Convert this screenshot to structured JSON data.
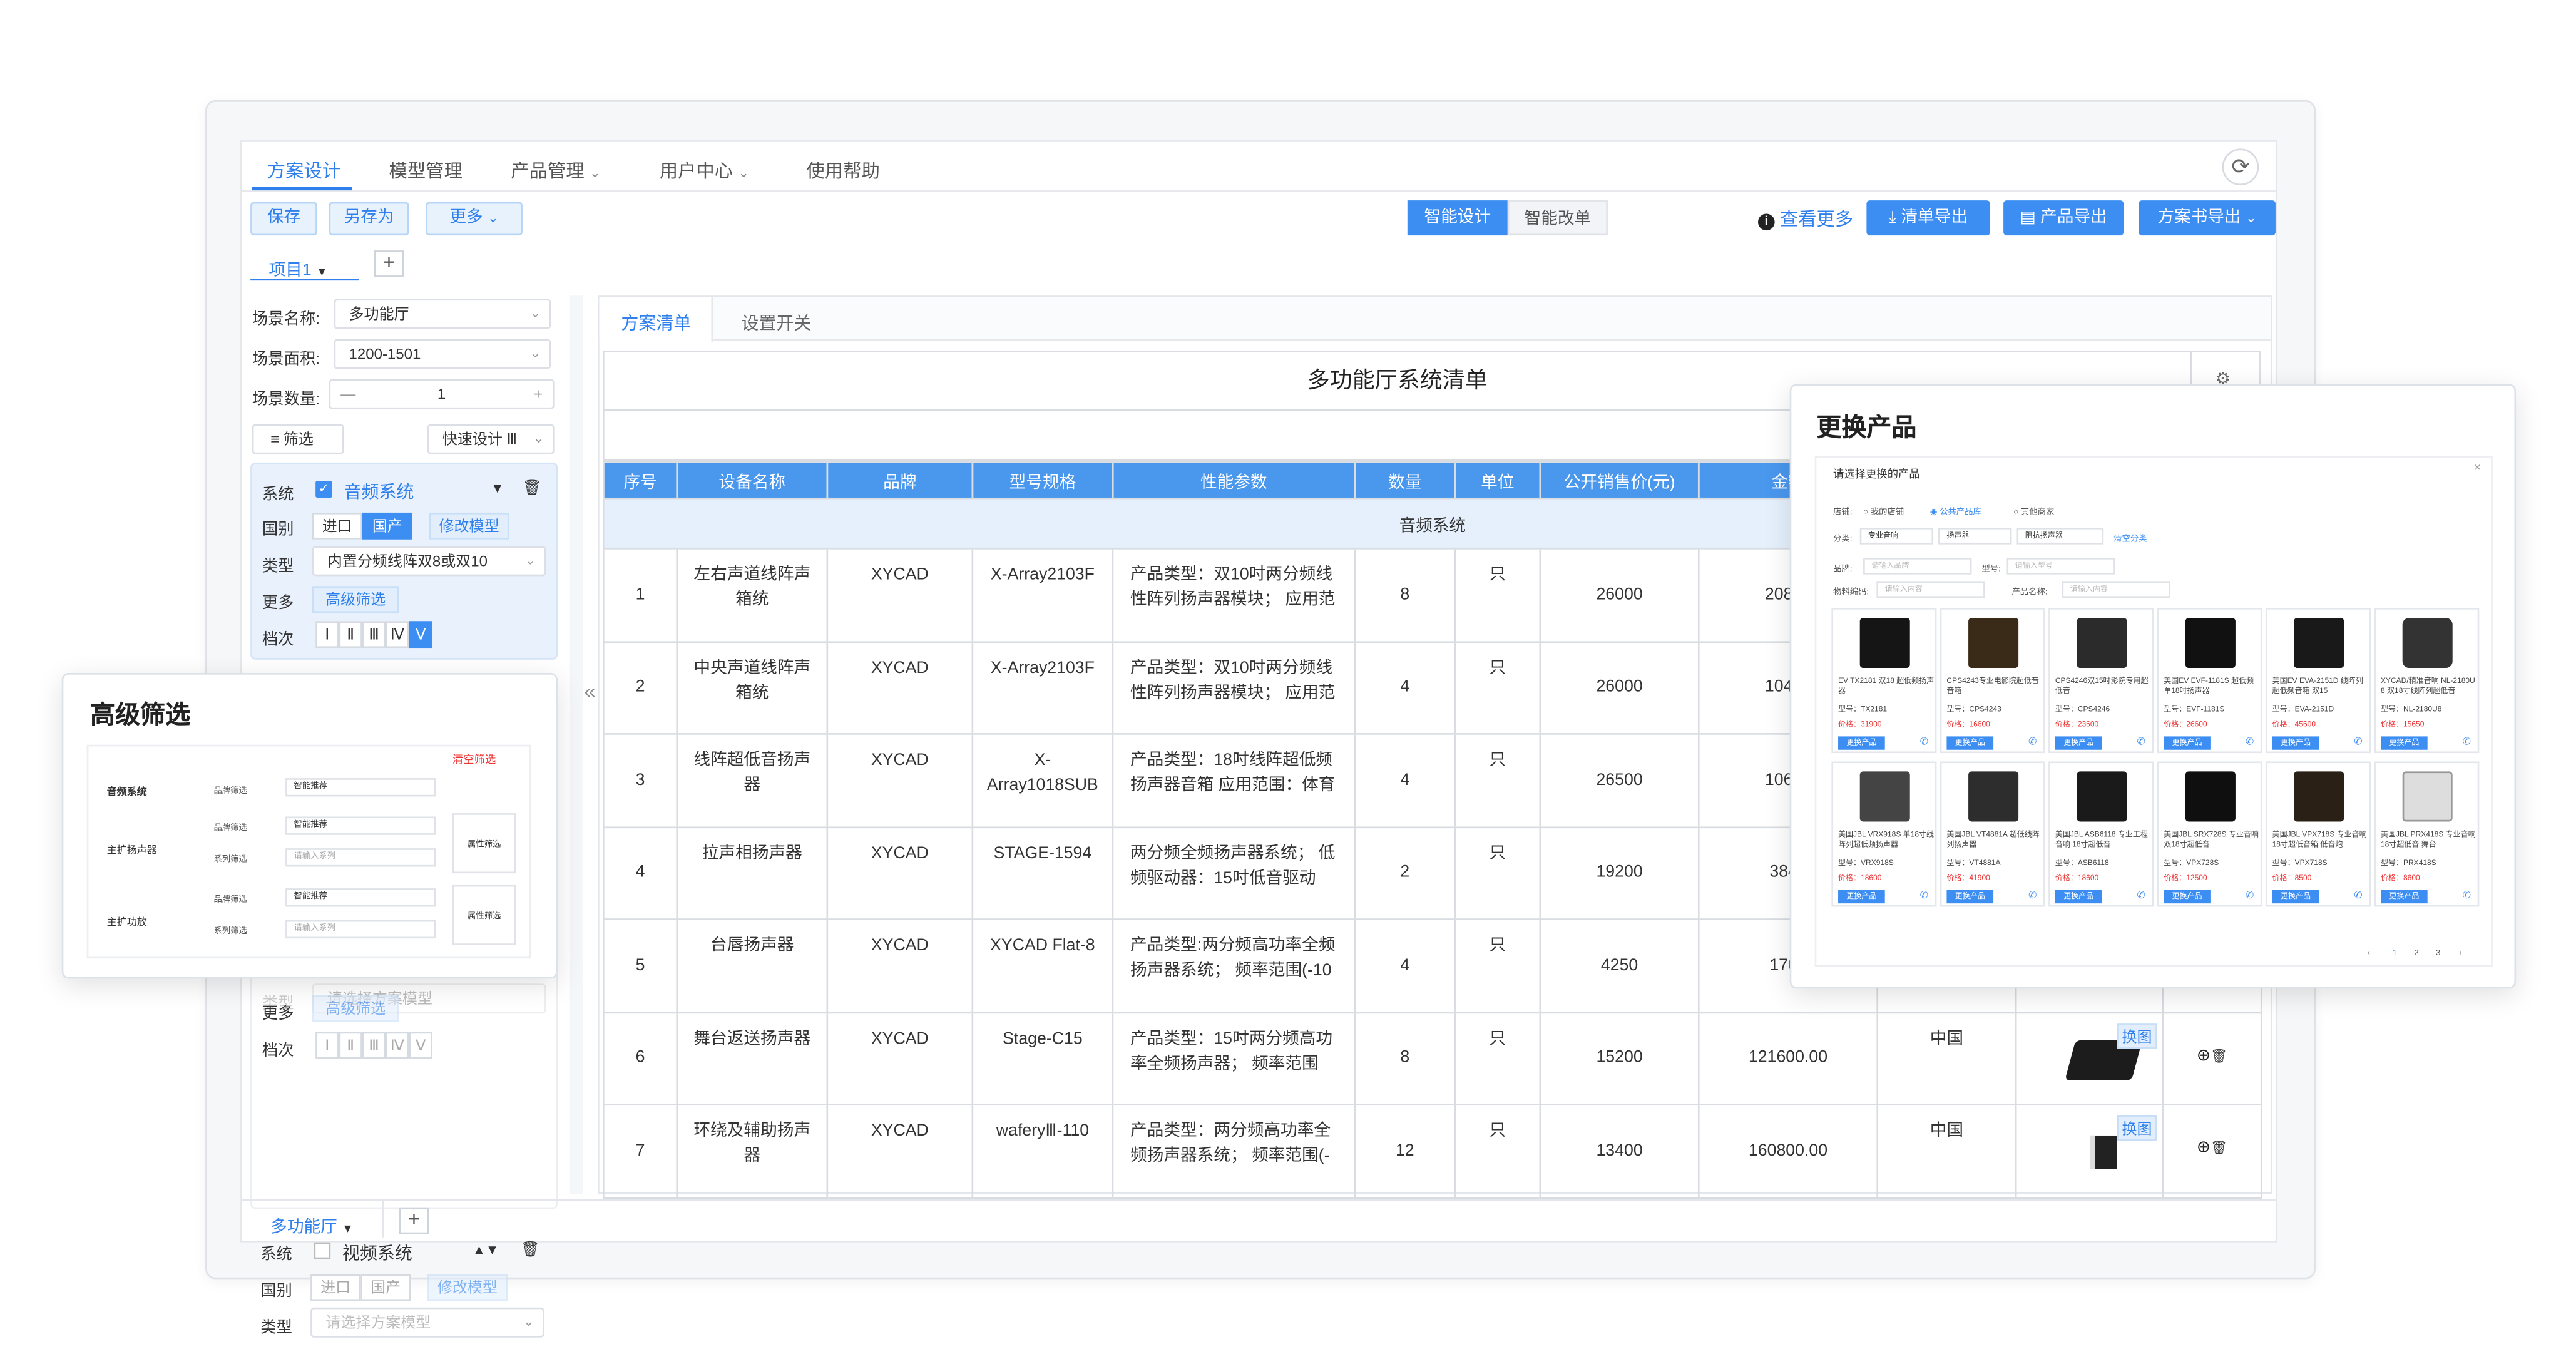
{
  "nav": {
    "items": [
      "方案设计",
      "模型管理",
      "产品管理",
      "用户中心",
      "使用帮助"
    ],
    "active_index": 0
  },
  "toolbar": {
    "save": "保存",
    "save_as": "另存为",
    "more": "更多",
    "smart_design": "智能设计",
    "smart_modify": "智能改单",
    "view_more": "查看更多",
    "export_list": "清单导出",
    "export_products": "产品导出",
    "export_plan": "方案书导出"
  },
  "project_tab": "项目1",
  "bottom_tab": "多功能厅",
  "left": {
    "scene_name_label": "场景名称:",
    "scene_name": "多功能厅",
    "scene_area_label": "场景面积:",
    "scene_area": "1200-1501",
    "scene_count_label": "场景数量:",
    "scene_count": "1",
    "filter": "筛选",
    "quick_design": "快速设计 Ⅲ",
    "sys_label": "系统",
    "audio_system": "音频系统",
    "country_label": "国别",
    "import": "进口",
    "domestic": "国产",
    "modify_model": "修改模型",
    "type_label": "类型",
    "type_value": "内置分频线阵双8或双10",
    "more_label": "更多",
    "adv_filter": "高级筛选",
    "grade_label": "档次",
    "grades": [
      "Ⅰ",
      "Ⅱ",
      "Ⅲ",
      "Ⅳ",
      "Ⅴ"
    ],
    "video_system": "视频系统",
    "type_placeholder": "请选择方案模型"
  },
  "right_tabs": [
    "方案清单",
    "设置开关"
  ],
  "table": {
    "title": "多功能厅系统清单",
    "headers": [
      "序号",
      "设备名称",
      "品牌",
      "型号规格",
      "性能参数",
      "数量",
      "单位",
      "公开销售价(元)",
      "金额"
    ],
    "category": "音频系统",
    "change_image": "换图",
    "rows": [
      {
        "no": "1",
        "name": "左右声道线阵声箱统",
        "brand": "XYCAD",
        "model": "X-Array2103F",
        "spec": "产品类型：双10吋两分频线性阵列扬声器模块； 应用范",
        "qty": "8",
        "unit": "只",
        "price": "26000",
        "amount": "20800",
        "origin": ""
      },
      {
        "no": "2",
        "name": "中央声道线阵声箱统",
        "brand": "XYCAD",
        "model": "X-Array2103F",
        "spec": "产品类型：双10吋两分频线性阵列扬声器模块； 应用范",
        "qty": "4",
        "unit": "只",
        "price": "26000",
        "amount": "10400",
        "origin": ""
      },
      {
        "no": "3",
        "name": "线阵超低音扬声器",
        "brand": "XYCAD",
        "model": "X-Array1018SUB",
        "spec": "产品类型：18吋线阵超低频扬声器音箱 应用范围：体育",
        "qty": "4",
        "unit": "只",
        "price": "26500",
        "amount": "10600",
        "origin": ""
      },
      {
        "no": "4",
        "name": "拉声相扬声器",
        "brand": "XYCAD",
        "model": "STAGE-1594",
        "spec": "两分频全频扬声器系统； 低频驱动器：15吋低音驱动",
        "qty": "2",
        "unit": "只",
        "price": "19200",
        "amount": "3840",
        "origin": ""
      },
      {
        "no": "5",
        "name": "台唇扬声器",
        "brand": "XYCAD",
        "model": "XYCAD Flat-8",
        "spec": "产品类型:两分频高功率全频扬声器系统； 频率范围(-10",
        "qty": "4",
        "unit": "只",
        "price": "4250",
        "amount": "1700",
        "origin": ""
      },
      {
        "no": "6",
        "name": "舞台返送扬声器",
        "brand": "XYCAD",
        "model": "Stage-C15",
        "spec": "产品类型：15吋两分频高功率全频扬声器； 频率范围",
        "qty": "8",
        "unit": "只",
        "price": "15200",
        "amount": "121600.00",
        "origin": "中国"
      },
      {
        "no": "7",
        "name": "环绕及辅助扬声器",
        "brand": "XYCAD",
        "model": "waferyⅢ-110",
        "spec": "产品类型：两分频高功率全频扬声器系统； 频率范围(-",
        "qty": "12",
        "unit": "只",
        "price": "13400",
        "amount": "160800.00",
        "origin": "中国"
      }
    ]
  },
  "adv_popup": {
    "title": "高级筛选",
    "clear": "清空筛选",
    "rows": [
      {
        "group": "音频系统",
        "fields": [
          {
            "label": "品牌筛选",
            "value": "智能推荐"
          }
        ],
        "attr": ""
      },
      {
        "group": "主扩扬声器",
        "fields": [
          {
            "label": "品牌筛选",
            "value": "智能推荐"
          },
          {
            "label": "系列筛选",
            "value": "请输入系列"
          }
        ],
        "attr": "属性筛选"
      },
      {
        "group": "主扩功放",
        "fields": [
          {
            "label": "品牌筛选",
            "value": "智能推荐"
          },
          {
            "label": "系列筛选",
            "value": "请输入系列"
          }
        ],
        "attr": "属性筛选"
      }
    ]
  },
  "replace_popup": {
    "title": "更换产品",
    "subtitle": "请选择更换的产品",
    "store_label": "店铺:",
    "stores": [
      "我的店铺",
      "公共产品库",
      "其他商家"
    ],
    "category_label": "分类:",
    "categories": [
      "专业音响",
      "扬声器",
      "阻抗扬声器"
    ],
    "clear_category": "清空分类",
    "brand_label": "品牌:",
    "brand_placeholder": "请输入品牌",
    "model_label": "型号:",
    "model_placeholder": "请输入型号",
    "material_label": "物料编码:",
    "material_placeholder": "请输入内容",
    "product_name_label": "产品名称:",
    "product_name_placeholder": "请输入内容",
    "replace_btn": "更换产品",
    "cards": [
      {
        "title": "EV TX2181 双18 超低频扬声器",
        "model": "型号：TX2181",
        "price": "价格：31900"
      },
      {
        "title": "CPS4243专业电影院超低音音箱",
        "model": "型号：CPS4243",
        "price": "价格：16600"
      },
      {
        "title": "CPS4246双15吋影院专用超低音",
        "model": "型号：CPS4246",
        "price": "价格：23600"
      },
      {
        "title": "美国EV EVF-1181S 超低频单18吋扬声器",
        "model": "型号：EVF-1181S",
        "price": "价格：26600"
      },
      {
        "title": "美国EV EVA-2151D 线阵列超低频音箱 双15",
        "model": "型号：EVA-2151D",
        "price": "价格：45600"
      },
      {
        "title": "XYCAD/精准音响 NL-2180U 8 双18寸线阵列超低音",
        "model": "型号：NL-2180U8",
        "price": "价格：15650"
      },
      {
        "title": "美国JBL VRX918S 单18寸线阵列超低频扬声器",
        "model": "型号：VRX918S",
        "price": "价格：18600"
      },
      {
        "title": "美国JBL VT4881A 超低线阵列扬声器",
        "model": "型号：VT4881A",
        "price": "价格：41900"
      },
      {
        "title": "美国JBL ASB6118 专业工程音响 18寸超低音",
        "model": "型号：ASB6118",
        "price": "价格：18600"
      },
      {
        "title": "美国JBL SRX728S 专业音响 双18寸超低音",
        "model": "型号：VPX728S",
        "price": "价格：12500"
      },
      {
        "title": "美国JBL VPX718S 专业音响 18寸超低音箱 低音炮",
        "model": "型号：VPX718S",
        "price": "价格：8500"
      },
      {
        "title": "美国JBL PRX418S 专业音响 18寸超低音 舞台",
        "model": "型号：PRX418S",
        "price": "价格：8600"
      }
    ],
    "pages": [
      "1",
      "2",
      "3"
    ]
  }
}
